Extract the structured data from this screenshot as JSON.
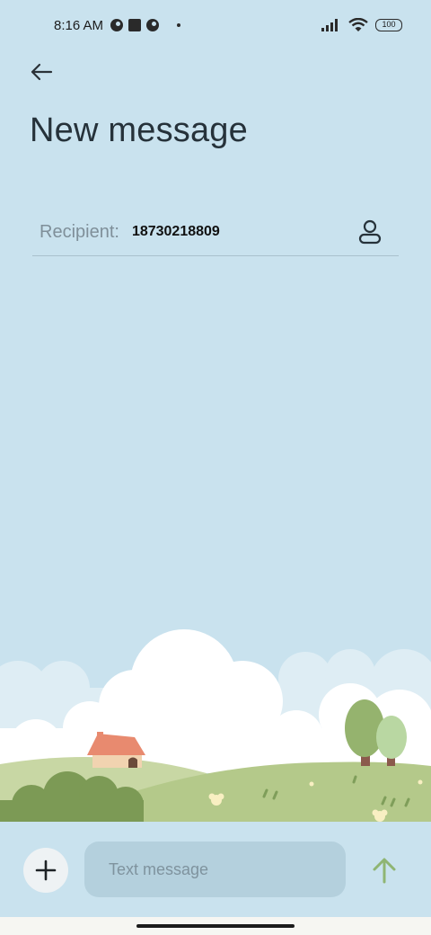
{
  "status_bar": {
    "time": "8:16 AM",
    "battery": "100",
    "icons": [
      "app-notification-icon",
      "square-notification-icon",
      "app-notification-icon",
      "dot-icon",
      "signal-icon",
      "wifi-icon",
      "battery-icon"
    ]
  },
  "header": {
    "back_icon": "arrow-left-icon",
    "title": "New message"
  },
  "recipient": {
    "label": "Recipient:",
    "value": "18730218809",
    "contact_icon": "person-icon"
  },
  "composer": {
    "add_icon": "plus-icon",
    "placeholder": "Text message",
    "value": "",
    "send_icon": "arrow-up-icon"
  },
  "colors": {
    "background": "#c9e2ee",
    "input_background": "#b4d0dd",
    "send_accent": "#8fb573"
  }
}
